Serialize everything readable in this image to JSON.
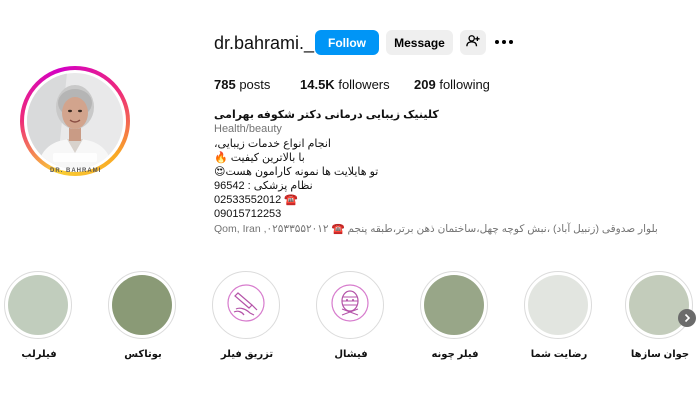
{
  "profile": {
    "username": "dr.bahrami._",
    "follow_label": "Follow",
    "message_label": "Message",
    "add_user_icon": "add-user-icon",
    "more_icon": "more-options-icon",
    "avatar_caption": "DR. BAHRAMI"
  },
  "stats": {
    "posts_value": "785",
    "posts_label": "posts",
    "followers_value": "14.5K",
    "followers_label": "followers",
    "following_value": "209",
    "following_label": "following"
  },
  "bio": {
    "name": "کلینیک زیبایی درمانی دکتر شکوفه بهرامی",
    "category": "Health/beauty",
    "line1": "انجام انواع خدمات زیبایی،",
    "line2": "با بالاترین کیفیت 🔥",
    "line3": "تو هایلایت ها نمونه کارامون هست😍",
    "line4": "نظام پزشکی : 96542",
    "line5": "02533552012 ☎️",
    "line6": "09015712253",
    "location": "Qom, Iran ,۰۲۵۳۳۵۵۲۰۱۲ ☎️ بلوار صدوقی (زنبیل آباد) ،نبش کوچه چهل،ساختمان ذهن برتر،طبقه پنجم"
  },
  "highlights": [
    {
      "label": "فیلرلب",
      "color": "#c1cdbd",
      "icon": ""
    },
    {
      "label": "بوتاکس",
      "color": "#8a9a76",
      "icon": ""
    },
    {
      "label": "تزریق فیلر",
      "color": "#ffffff",
      "icon": "syringe-hand-icon"
    },
    {
      "label": "فیشال",
      "color": "#ffffff",
      "icon": "face-mask-icon"
    },
    {
      "label": "فیلر چونه",
      "color": "#98a688",
      "icon": ""
    },
    {
      "label": "رضایت شما",
      "color": "#e2e5e0",
      "icon": ""
    },
    {
      "label": "جوان سازها",
      "color": "#c3ccbb",
      "icon": ""
    }
  ],
  "next_arrow_icon": "chevron-right-icon"
}
